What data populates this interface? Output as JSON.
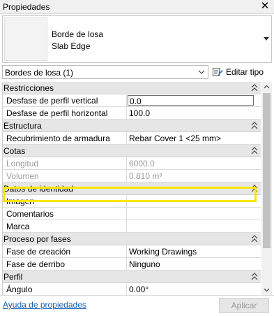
{
  "panel": {
    "title": "Propiedades"
  },
  "type_selector": {
    "line1": "Borde de losa",
    "line2": "Slab Edge"
  },
  "filter": {
    "value": "Bordes de losa (1)",
    "edit_type_label": "Editar tipo"
  },
  "sections": {
    "restricciones": {
      "title": "Restricciones",
      "rows": [
        {
          "name": "Desfase de perfil vertical",
          "value": "0.0"
        },
        {
          "name": "Desfase de perfil horizontal",
          "value": "100.0"
        }
      ]
    },
    "estructura": {
      "title": "Estructura",
      "rows": [
        {
          "name": "Recubrimiento de armadura",
          "value": "Rebar Cover 1 <25 mm>"
        }
      ]
    },
    "cotas": {
      "title": "Cotas",
      "rows": [
        {
          "name": "Longitud",
          "value": "6000.0"
        },
        {
          "name": "Volumen",
          "value": "0.810 m³"
        }
      ]
    },
    "identidad": {
      "title": "Datos de identidad",
      "rows": [
        {
          "name": "Imagen",
          "value": ""
        },
        {
          "name": "Comentarios",
          "value": ""
        },
        {
          "name": "Marca",
          "value": ""
        }
      ]
    },
    "fases": {
      "title": "Proceso por fases",
      "rows": [
        {
          "name": "Fase de creación",
          "value": "Working Drawings"
        },
        {
          "name": "Fase de derribo",
          "value": "Ninguno"
        }
      ]
    },
    "perfil": {
      "title": "Perfil",
      "rows": [
        {
          "name": "Ángulo",
          "value": "0.00°"
        }
      ]
    }
  },
  "footer": {
    "help_link": "Ayuda de propiedades",
    "apply_label": "Aplicar"
  },
  "colors": {
    "highlight": "#ffe600",
    "link": "#1a5fb4",
    "section_bg": "#e6e6e6"
  }
}
